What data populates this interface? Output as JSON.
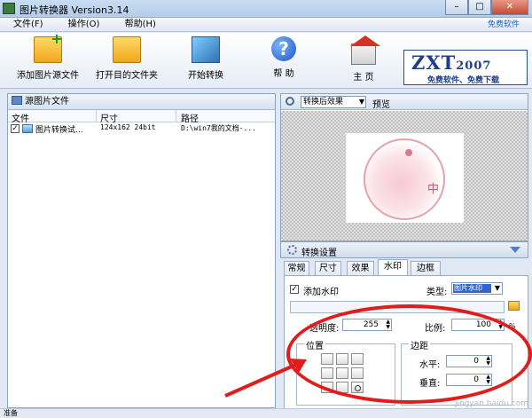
{
  "window": {
    "title": "图片转换器 Version3.14",
    "buttons": {
      "minimize": "–",
      "maximize": "□",
      "close": "✕"
    }
  },
  "menu": {
    "items": [
      "文件(F)",
      "操作(O)",
      "帮助(H)"
    ],
    "right_link": "免费软件"
  },
  "toolbar": {
    "add_source": "添加图片源文件",
    "open_dest": "打开目的文件夹",
    "start_convert": "开始转换",
    "help": "帮 助",
    "home": "主 页"
  },
  "logo": {
    "brand": "ZXT",
    "year": "2007",
    "slogan": "免费软件、免费下载"
  },
  "left_panel": {
    "title": "源图片文件",
    "columns": [
      "文件",
      "尺寸",
      "路径"
    ],
    "rows": [
      {
        "checked": "✓",
        "file": "图片转换试...",
        "size": "124x162  24bit",
        "path": "D:\\win7我的文档-..."
      }
    ]
  },
  "preview": {
    "mode": "转换后效果",
    "mode_arrow": "▼",
    "label": "预览",
    "seal_char": "中"
  },
  "settings": {
    "title": "转换设置",
    "tabs": [
      "常规",
      "尺寸",
      "效果",
      "水印",
      "边框"
    ],
    "active_tab": "水印",
    "add_watermark": {
      "checked": "✓",
      "label": "添加水印"
    },
    "type": {
      "label": "类型:",
      "value": "图片水印",
      "arrow": "▼"
    },
    "transparency": {
      "label": "透明度:",
      "value": "255"
    },
    "ratio": {
      "label": "比例:",
      "value": "100",
      "unit": "%"
    },
    "position": {
      "label": "位置"
    },
    "margin": {
      "label": "边距",
      "horizontal": {
        "label": "水平:",
        "value": "0"
      },
      "vertical": {
        "label": "垂直:",
        "value": "0"
      }
    }
  },
  "status": {
    "text": "准备"
  },
  "watermark_text": "jingyan.baidu.com"
}
